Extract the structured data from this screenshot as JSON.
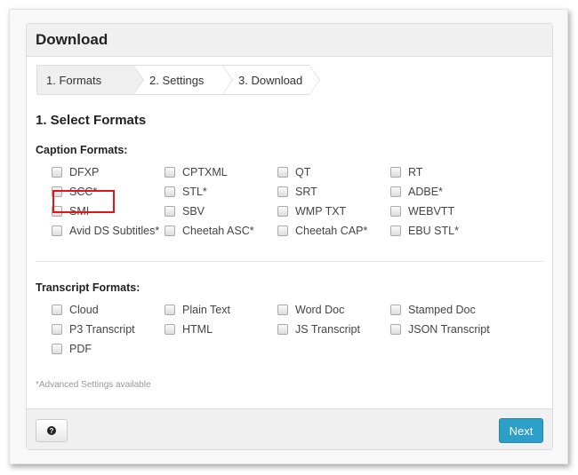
{
  "header": {
    "title": "Download"
  },
  "stepper": {
    "steps": [
      {
        "label": "1. Formats",
        "active": true
      },
      {
        "label": "2. Settings",
        "active": false
      },
      {
        "label": "3. Download",
        "active": false
      }
    ]
  },
  "section_title": "1. Select Formats",
  "caption": {
    "label": "Caption Formats:",
    "options": [
      "DFXP",
      "CPTXML",
      "QT",
      "RT",
      "SCC*",
      "STL*",
      "SRT",
      "ADBE*",
      "SMI",
      "SBV",
      "WMP TXT",
      "WEBVTT",
      "Avid DS Subtitles*",
      "Cheetah ASC*",
      "Cheetah CAP*",
      "EBU STL*"
    ]
  },
  "transcript": {
    "label": "Transcript Formats:",
    "options": [
      "Cloud",
      "Plain Text",
      "Word Doc",
      "Stamped Doc",
      "P3 Transcript",
      "HTML",
      "JS Transcript",
      "JSON Transcript",
      "PDF"
    ]
  },
  "note": "*Advanced Settings available",
  "highlighted_option": "SCC*",
  "footer": {
    "help_icon": "question-circle-icon",
    "next_label": "Next"
  },
  "colors": {
    "accent": "#2c9fc9",
    "highlight": "#e0151d"
  }
}
